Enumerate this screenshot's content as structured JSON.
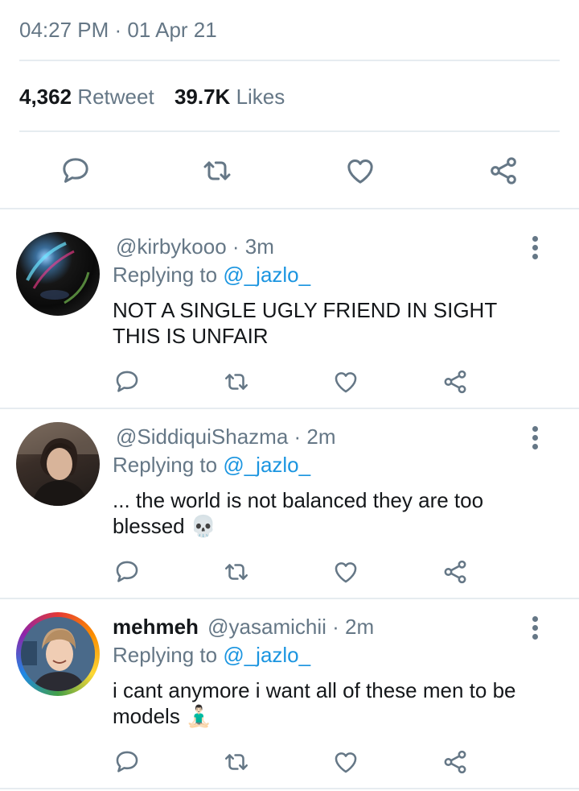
{
  "tweet": {
    "timestamp": "04:27 PM · 01 Apr 21",
    "retweet_count": "4,362",
    "retweet_label": "Retweet",
    "likes_count": "39.7K",
    "likes_label": "Likes"
  },
  "icons": {
    "reply": "reply-icon",
    "retweet": "retweet-icon",
    "like": "heart-icon",
    "share": "share-icon",
    "more": "more-vertical-icon"
  },
  "colors": {
    "text": "#14171a",
    "muted": "#657786",
    "link": "#1b95e0",
    "divider": "#e6ecf0"
  },
  "replies": [
    {
      "display_name": "",
      "handle": "@kirbykooo",
      "time": "· 3m",
      "replying_prefix": "Replying to",
      "replying_to": "@_jazlo_",
      "text": "NOT A SINGLE UGLY FRIEND IN SIGHT THIS IS UNFAIR",
      "emoji": ""
    },
    {
      "display_name": "",
      "handle": "@SiddiquiShazma",
      "time": "· 2m",
      "replying_prefix": "Replying to",
      "replying_to": "@_jazlo_",
      "text": "... the world is not balanced they are too blessed",
      "emoji": "💀"
    },
    {
      "display_name": "mehmeh",
      "handle": "@yasamichii",
      "time": "· 2m",
      "replying_prefix": "Replying to",
      "replying_to": "@_jazlo_",
      "text": "i cant anymore i want all of these men to be models",
      "emoji": "🧘🏻‍♂️"
    }
  ]
}
